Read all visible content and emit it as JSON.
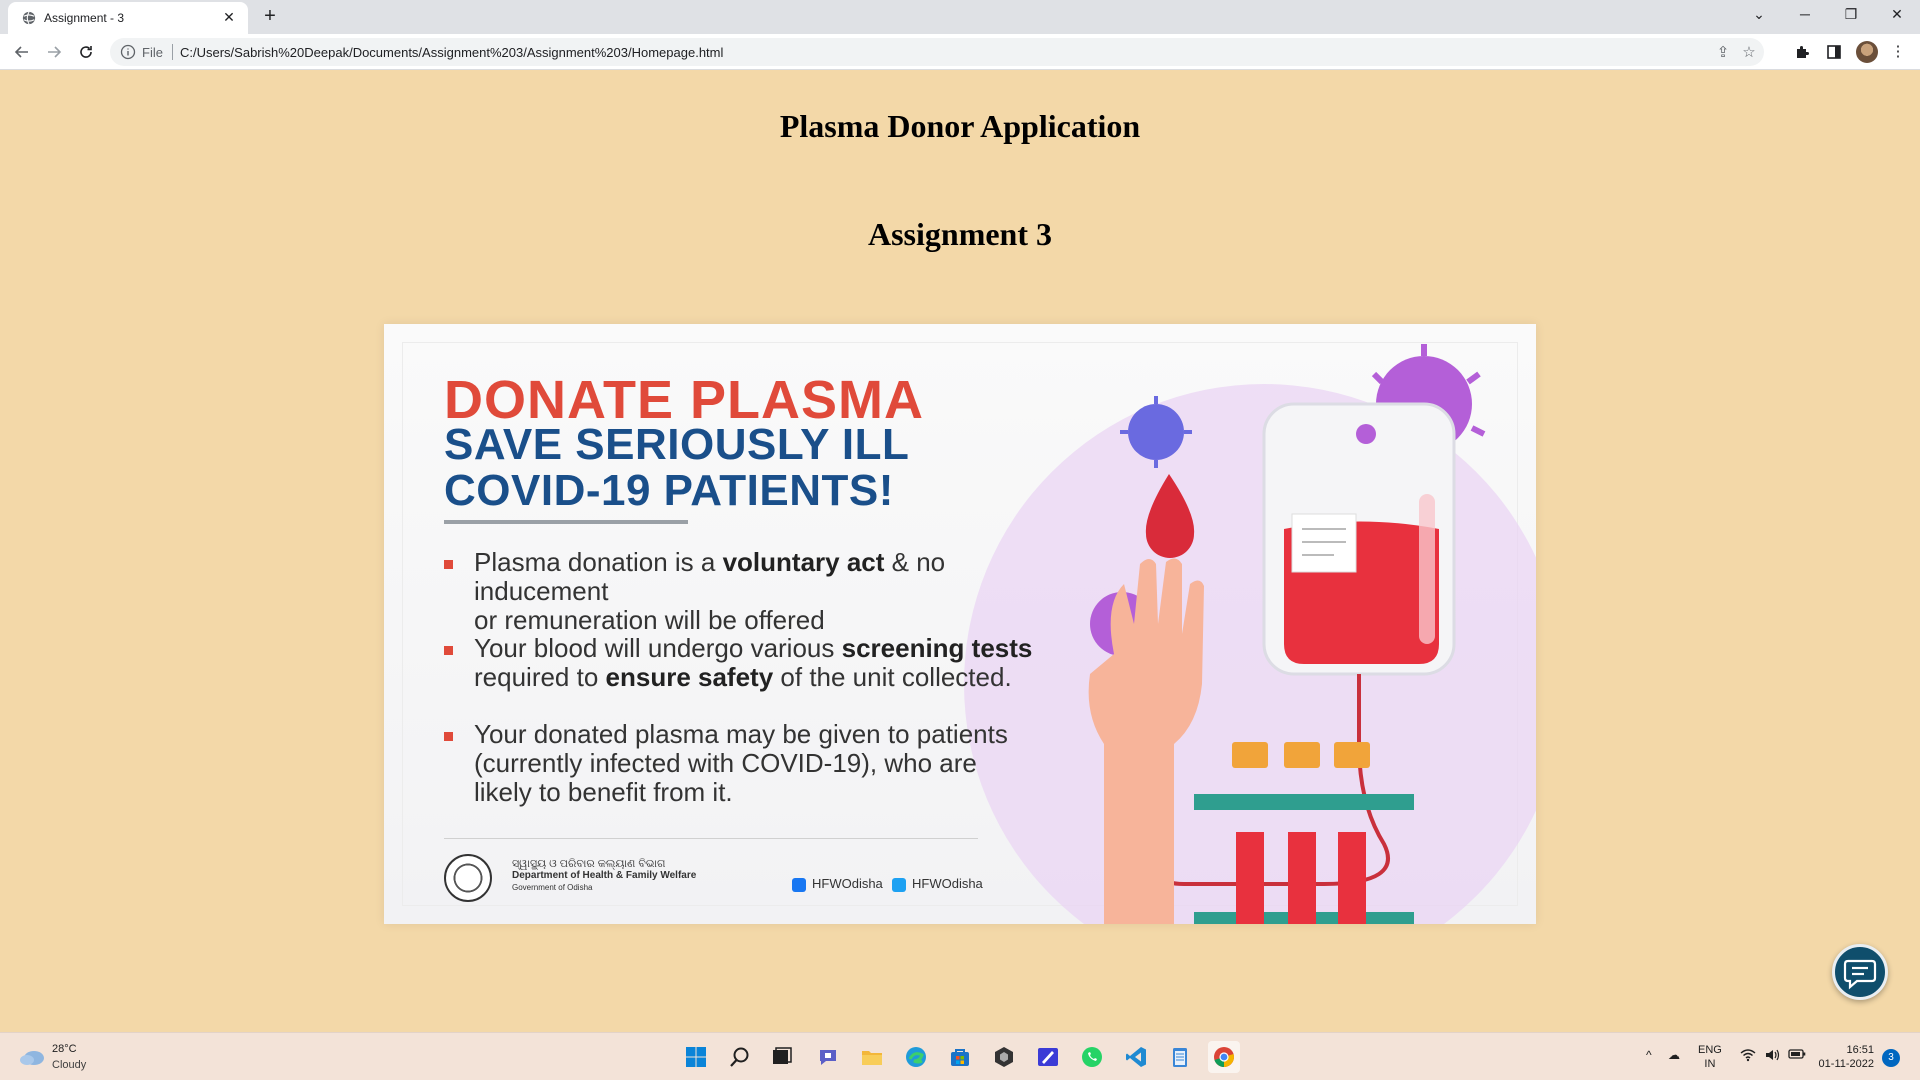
{
  "browser": {
    "tab_title": "Assignment - 3",
    "close_glyph": "✕",
    "newtab_glyph": "+",
    "window_controls": {
      "dropdown": "⌄",
      "minimize": "─",
      "restore": "❐",
      "close": "✕"
    },
    "file_label": "File",
    "url": "C:/Users/Sabrish%20Deepak/Documents/Assignment%203/Assignment%203/Homepage.html"
  },
  "page": {
    "title": "Plasma Donor Application",
    "subtitle": "Assignment 3"
  },
  "poster": {
    "headline1": "DONATE PLASMA",
    "headline2_line1": "SAVE SERIOUSLY ILL",
    "headline2_line2": "COVID-19 PATIENTS!",
    "bullets": [
      {
        "pre": "Plasma donation is a ",
        "bold": "voluntary act",
        "post": " & no inducement",
        "line2": "or remuneration will be offered"
      },
      {
        "pre": "Your blood will undergo various ",
        "bold": "screening tests",
        "post": "",
        "line2pre": "required to ",
        "line2bold": "ensure safety",
        "line2post": " of the unit collected."
      },
      {
        "line1": "Your donated plasma may be given to patients",
        "line2": "(currently infected with COVID-19), who are",
        "line3": "likely to benefit from it."
      }
    ],
    "dept_odia": "ସ୍ୱାସ୍ଥ୍ୟ ଓ ପରିବାର କଲ୍ୟାଣ ବିଭାଗ",
    "dept_name": "Department of Health & Family Welfare",
    "dept_gov": "Government of Odisha",
    "facebook": "HFWOdisha",
    "twitter": "HFWOdisha"
  },
  "taskbar": {
    "temperature": "28°C",
    "weather": "Cloudy",
    "lang_line1": "ENG",
    "lang_line2": "IN",
    "time": "16:51",
    "date": "01-11-2022",
    "notifications": "3"
  },
  "colors": {
    "page_bg": "#f3d8a8",
    "poster_red": "#e04a3a",
    "poster_blue": "#1a4f8a",
    "chat_button": "#0f4e6c"
  }
}
